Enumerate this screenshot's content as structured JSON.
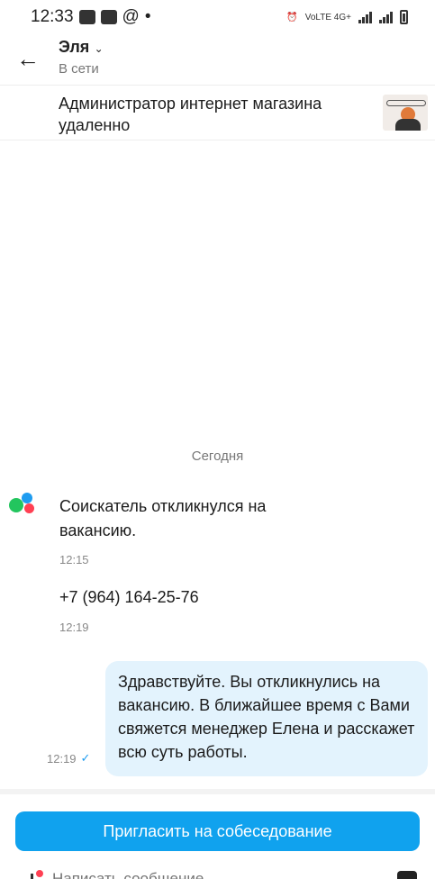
{
  "status_bar": {
    "time": "12:33",
    "network_label": "VoLTE 4G+"
  },
  "header": {
    "back_icon": "arrow-left-icon",
    "contact_name": "Эля",
    "status": "В сети"
  },
  "vacancy": {
    "title": "Администратор интернет магазина удаленно",
    "thumbnail_icon": "vacancy-image"
  },
  "chat": {
    "date_separator": "Сегодня",
    "messages": [
      {
        "text": "Соискатель откликнулся на вакансию.",
        "time": "12:15"
      },
      {
        "text": "+7 (964) 164-25-76",
        "time": "12:19"
      }
    ],
    "outgoing": {
      "text": "Здравствуйте. Вы откликнулись на вакансию. В ближайшее время с Вами свяжется менеджер Елена и расскажет всю суть работы.",
      "time": "12:19",
      "status_icon": "check-icon"
    }
  },
  "actions": {
    "invite_label": "Пригласить на собеседование"
  },
  "composer": {
    "placeholder": "Написать сообщение"
  },
  "colors": {
    "accent": "#10a2ee",
    "outgoing_bubble": "#e3f3fd",
    "online_text": "#777777"
  }
}
